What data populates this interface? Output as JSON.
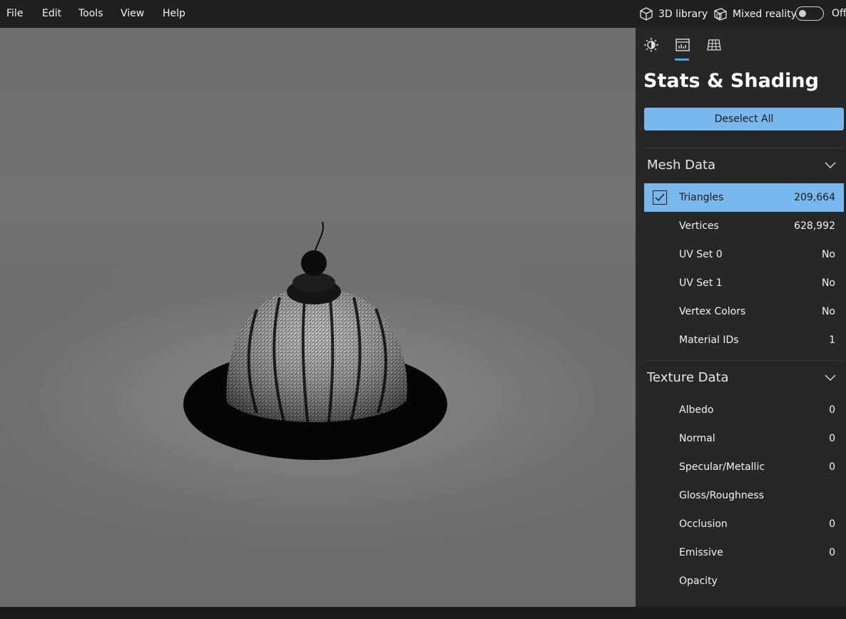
{
  "menu": {
    "file": "File",
    "edit": "Edit",
    "tools": "Tools",
    "view": "View",
    "help": "Help"
  },
  "topbar": {
    "library_label": "3D library",
    "mixed_reality_label": "Mixed reality",
    "mixed_reality_state": "Off"
  },
  "panel": {
    "tabs": [
      {
        "icon": "lighting-icon"
      },
      {
        "icon": "stats-icon",
        "active": true
      },
      {
        "icon": "grid-icon"
      }
    ],
    "title": "Stats & Shading",
    "deselect_label": "Deselect All",
    "mesh": {
      "title": "Mesh Data",
      "rows": [
        {
          "label": "Triangles",
          "value": "209,664",
          "selected": true
        },
        {
          "label": "Vertices",
          "value": "628,992"
        },
        {
          "label": "UV Set 0",
          "value": "No"
        },
        {
          "label": "UV Set 1",
          "value": "No"
        },
        {
          "label": "Vertex Colors",
          "value": "No"
        },
        {
          "label": "Material IDs",
          "value": "1"
        }
      ]
    },
    "texture": {
      "title": "Texture Data",
      "rows": [
        {
          "label": "Albedo",
          "value": "0"
        },
        {
          "label": "Normal",
          "value": "0"
        },
        {
          "label": "Specular/Metallic",
          "value": "0"
        },
        {
          "label": "Gloss/Roughness",
          "value": ""
        },
        {
          "label": "Occlusion",
          "value": "0"
        },
        {
          "label": "Emissive",
          "value": "0"
        },
        {
          "label": "Opacity",
          "value": ""
        }
      ]
    }
  },
  "colors": {
    "accent": "#79b8ec",
    "tab_indicator": "#4aa3f0",
    "panel_bg": "#272727",
    "menubar_bg": "#202020"
  }
}
